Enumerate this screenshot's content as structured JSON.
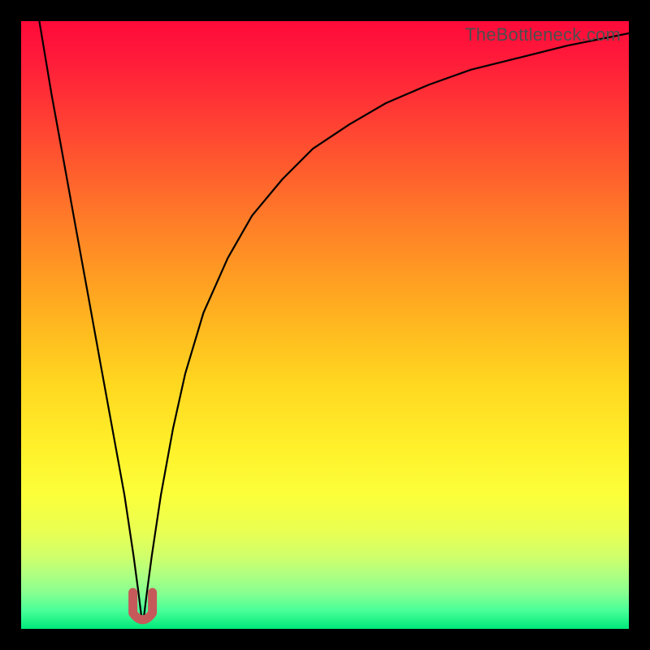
{
  "watermark": "TheBottleneck.com",
  "chart_data": {
    "type": "line",
    "title": "",
    "xlabel": "",
    "ylabel": "",
    "xlim": [
      0,
      100
    ],
    "ylim": [
      0,
      100
    ],
    "grid": false,
    "legend": false,
    "series": [
      {
        "name": "bottleneck-curve",
        "color": "#000000",
        "x": [
          3,
          5,
          7,
          9,
          11,
          13,
          15,
          17,
          18.5,
          19.3,
          19.8,
          20.2,
          20.7,
          21.5,
          23,
          25,
          27,
          30,
          34,
          38,
          43,
          48,
          54,
          60,
          67,
          74,
          82,
          90,
          100
        ],
        "y": [
          100,
          88,
          77,
          66,
          55,
          44,
          33,
          22,
          12,
          6,
          2,
          2,
          6,
          12,
          22,
          33,
          42,
          52,
          61,
          68,
          74,
          79,
          83,
          86.5,
          89.5,
          92,
          94,
          96,
          98
        ]
      }
    ],
    "markers": [
      {
        "name": "trough-marker",
        "shape": "u",
        "color": "#c65a5a",
        "x": 20,
        "y": 1.5,
        "width_x": 3.2,
        "height_y": 4.5
      }
    ],
    "background_gradient": {
      "orientation": "vertical",
      "stops": [
        {
          "pos": 0.0,
          "color": "#ff0a3a"
        },
        {
          "pos": 0.5,
          "color": "#ffd820"
        },
        {
          "pos": 0.8,
          "color": "#fbff3a"
        },
        {
          "pos": 1.0,
          "color": "#00e87a"
        }
      ]
    }
  }
}
